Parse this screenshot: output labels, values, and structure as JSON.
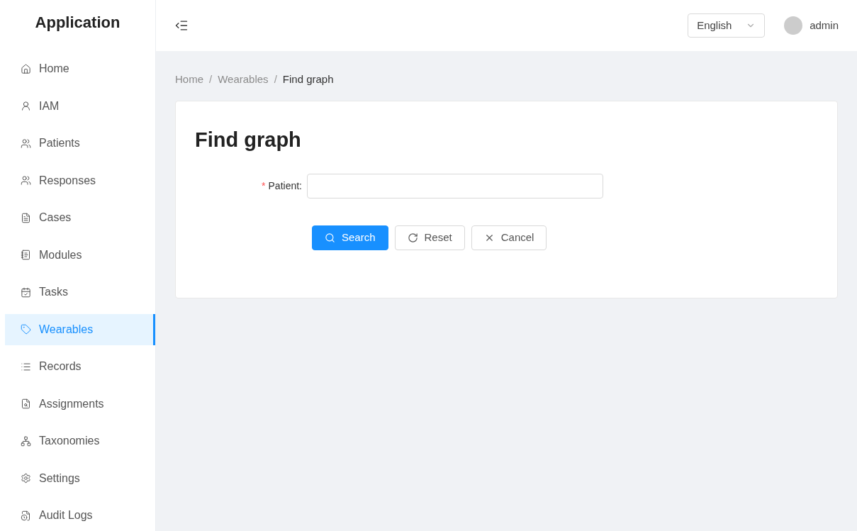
{
  "app": {
    "title": "Application"
  },
  "sidebar": {
    "items": [
      {
        "label": "Home",
        "selected": false
      },
      {
        "label": "IAM",
        "selected": false
      },
      {
        "label": "Patients",
        "selected": false
      },
      {
        "label": "Responses",
        "selected": false
      },
      {
        "label": "Cases",
        "selected": false
      },
      {
        "label": "Modules",
        "selected": false
      },
      {
        "label": "Tasks",
        "selected": false
      },
      {
        "label": "Wearables",
        "selected": true
      },
      {
        "label": "Records",
        "selected": false
      },
      {
        "label": "Assignments",
        "selected": false
      },
      {
        "label": "Taxonomies",
        "selected": false
      },
      {
        "label": "Settings",
        "selected": false
      },
      {
        "label": "Audit Logs",
        "selected": false
      }
    ]
  },
  "header": {
    "language": "English",
    "user": "admin"
  },
  "breadcrumb": [
    "Home",
    "Wearables",
    "Find graph"
  ],
  "breadcrumb_separator": "/",
  "form": {
    "title": "Find graph",
    "fields": [
      {
        "label": "Patient:",
        "required_mark": "*"
      }
    ],
    "buttons": [
      {
        "label": "Search",
        "kind": "primary"
      },
      {
        "label": "Reset",
        "kind": "default"
      },
      {
        "label": "Cancel",
        "kind": "default"
      }
    ]
  }
}
